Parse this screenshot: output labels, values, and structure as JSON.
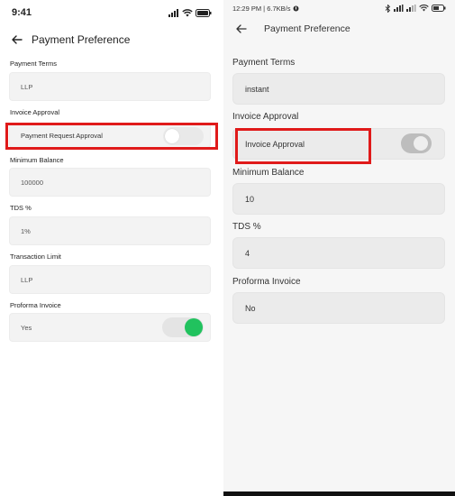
{
  "left": {
    "status_time": "9:41",
    "title": "Payment Preference",
    "fields": [
      {
        "label": "Payment Terms",
        "value": "LLP"
      },
      {
        "label": "Invoice Approval",
        "value": "Payment Request Approval"
      },
      {
        "label": "Minimum Balance",
        "value": "100000"
      },
      {
        "label": "TDS %",
        "value": "1%"
      },
      {
        "label": "Transaction Limit",
        "value": "LLP"
      },
      {
        "label": "Proforma Invoice",
        "value": "Yes"
      }
    ],
    "invoice_approval_toggle": "off",
    "proforma_toggle": "on",
    "toggle_on_color": "#21c25e"
  },
  "right": {
    "status_time": "12:29 PM | 6.7KB/s",
    "title": "Payment Preference",
    "fields": [
      {
        "label": "Payment Terms",
        "value": "instant"
      },
      {
        "label": "Invoice Approval",
        "value": "Invoice Approval"
      },
      {
        "label": "Minimum Balance",
        "value": "10"
      },
      {
        "label": "TDS %",
        "value": "4"
      },
      {
        "label": "Proforma Invoice",
        "value": "No"
      }
    ],
    "invoice_approval_toggle": "off"
  },
  "highlight_color": "#e01a1a"
}
